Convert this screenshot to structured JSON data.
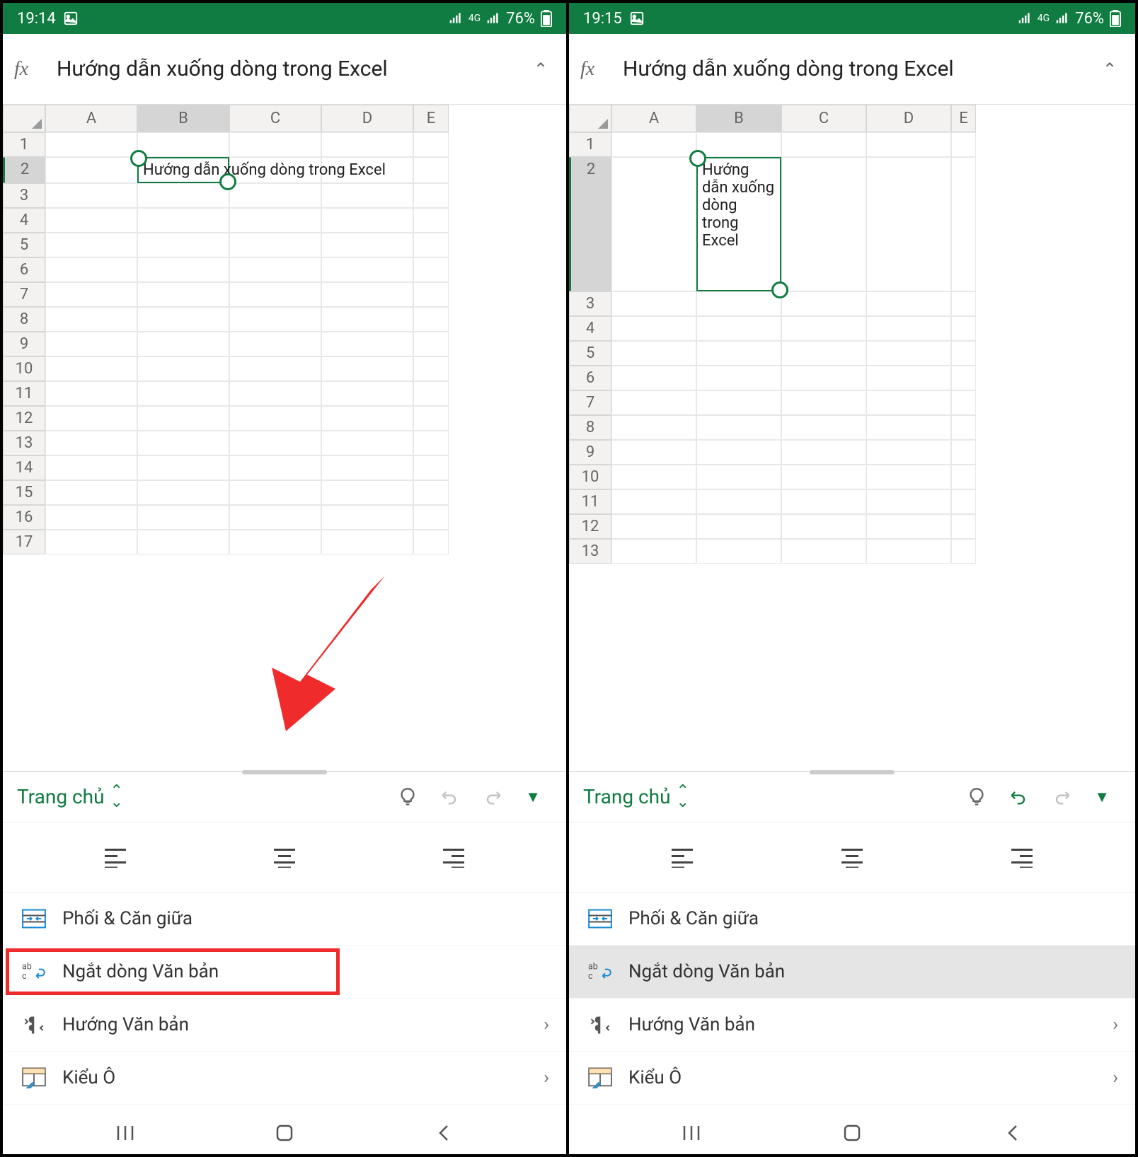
{
  "left": {
    "status": {
      "time": "19:14",
      "network": "4G",
      "battery": "76%"
    },
    "formula": "Hướng dẫn xuống dòng trong Excel",
    "columns": [
      "A",
      "B",
      "C",
      "D",
      "E"
    ],
    "rows": [
      1,
      2,
      3,
      4,
      5,
      6,
      7,
      8,
      9,
      10,
      11,
      12,
      13,
      14,
      15,
      16,
      17
    ],
    "selectedRow": 2,
    "selectedCol": "B",
    "cellTextB2": "Hướng dẫn xuống dòng trong Excel",
    "toolbar": {
      "title": "Trang chủ"
    },
    "panel": {
      "merge": "Phối & Căn giữa",
      "wrap": "Ngắt dòng Văn bản",
      "direction": "Hướng Văn bản",
      "cellstyle": "Kiểu Ô"
    }
  },
  "right": {
    "status": {
      "time": "19:15",
      "network": "4G",
      "battery": "76%"
    },
    "formula": "Hướng dẫn xuống dòng trong Excel",
    "columns": [
      "A",
      "B",
      "C",
      "D",
      "E"
    ],
    "rows": [
      1,
      2,
      3,
      4,
      5,
      6,
      7,
      8,
      9,
      10,
      11,
      12,
      13
    ],
    "selectedRow": 2,
    "selectedCol": "B",
    "cellTextB2": "Hướng dẫn xuống dòng trong Excel",
    "toolbar": {
      "title": "Trang chủ"
    },
    "panel": {
      "merge": "Phối & Căn giữa",
      "wrap": "Ngắt dòng Văn bản",
      "direction": "Hướng Văn bản",
      "cellstyle": "Kiểu Ô"
    }
  }
}
